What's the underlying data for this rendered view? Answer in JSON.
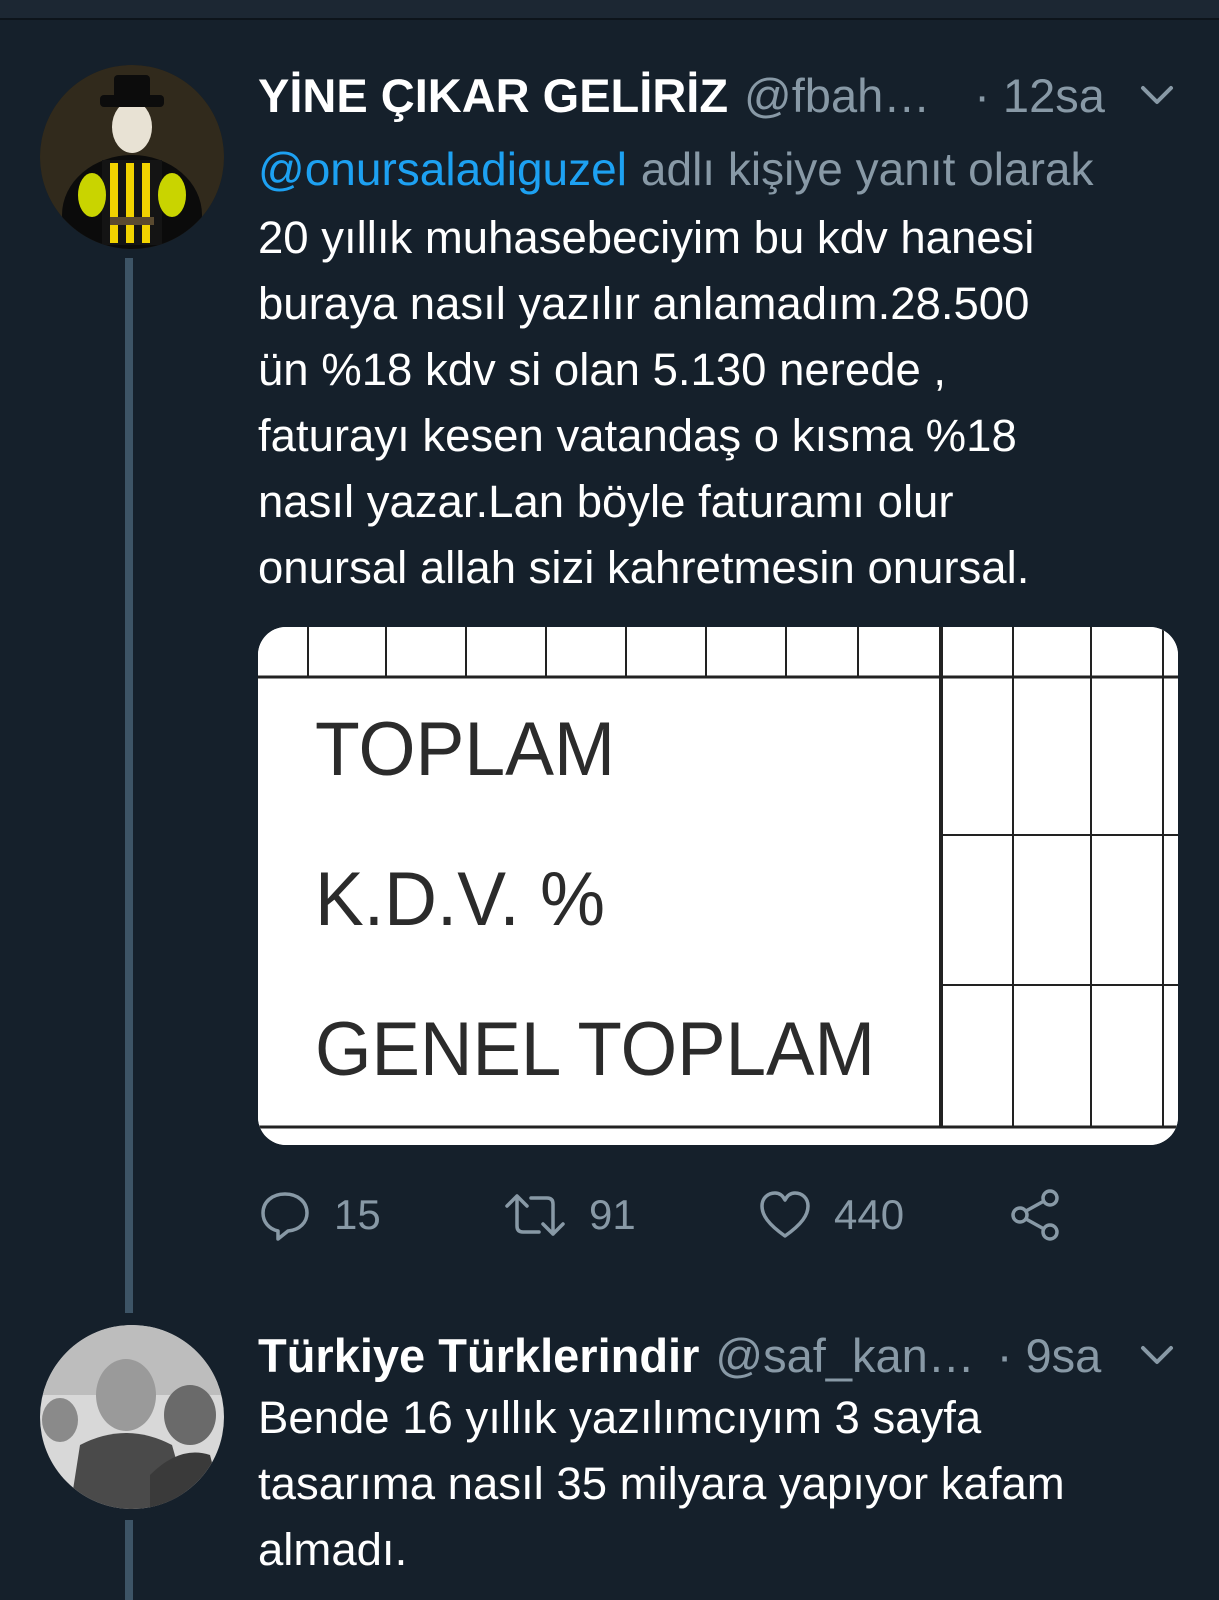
{
  "tweets": [
    {
      "name": "YİNE ÇIKAR GELİRİZ",
      "handle": "@fbah…",
      "time": "· 12sa",
      "reply_mention": "@onursaladiguzel",
      "reply_suffix": "adlı kişiye yanıt olarak",
      "text_lines": [
        "20 yıllık muhasebeciyim bu kdv hanesi",
        "buraya nasıl yazılır anlamadım.28.500",
        "ün %18 kdv si olan 5.130 nerede ,",
        "faturayı kesen vatandaş o kısma %18",
        "nasıl yazar.Lan böyle faturamı olur",
        "onursal allah sizi kahretmesin onursal."
      ],
      "media": {
        "lines": [
          "TOPLAM",
          "K.D.V. %",
          "GENEL TOPLAM"
        ]
      },
      "actions": {
        "replies": "15",
        "retweets": "91",
        "likes": "440"
      }
    },
    {
      "name": "Türkiye Türklerindir",
      "handle": "@saf_kan…",
      "time": "· 9sa",
      "text_lines": [
        "Bende 16 yıllık yazılımcıyım 3 sayfa",
        "tasarıma nasıl 35 milyara yapıyor kafam",
        "almadı."
      ]
    }
  ],
  "colors": {
    "background": "#15202b",
    "mention": "#1da1f2",
    "secondary_text": "#8899a6",
    "thread_line": "#3d5466"
  },
  "icons": {
    "caret": "chevron-down-icon",
    "reply": "reply-icon",
    "retweet": "retweet-icon",
    "like": "heart-icon",
    "share": "share-icon"
  }
}
